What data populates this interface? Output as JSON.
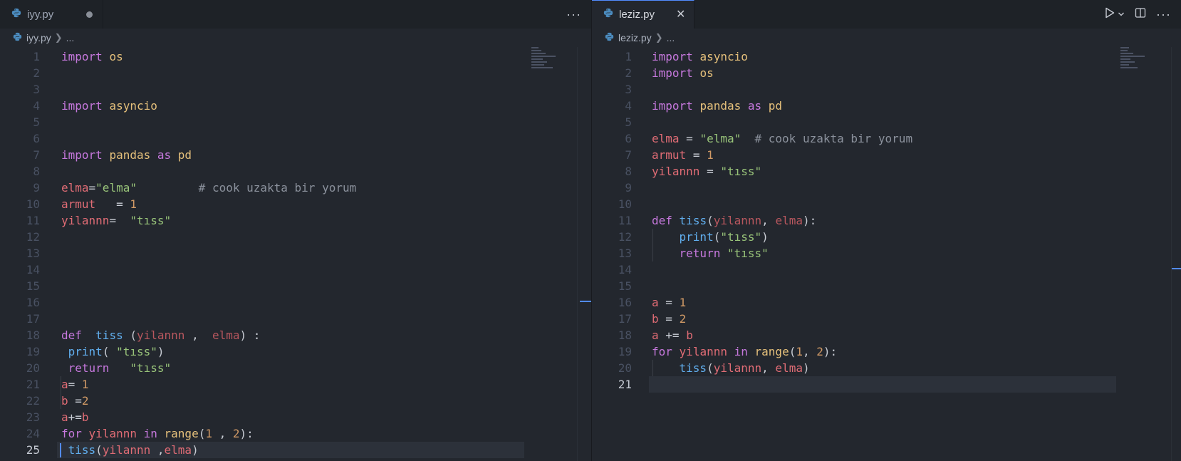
{
  "left": {
    "tab": {
      "label": "iyy.py",
      "modified": true
    },
    "breadcrumb": {
      "file": "iyy.py",
      "rest": "..."
    },
    "more_label": "···",
    "current_line": 25,
    "line_numbers": [
      "1",
      "2",
      "3",
      "4",
      "5",
      "6",
      "7",
      "8",
      "9",
      "10",
      "11",
      "12",
      "13",
      "14",
      "15",
      "16",
      "17",
      "18",
      "19",
      "20",
      "21",
      "22",
      "23",
      "24",
      "25"
    ]
  },
  "right": {
    "tab": {
      "label": "leziz.py",
      "close_label": "✕"
    },
    "breadcrumb": {
      "file": "leziz.py",
      "rest": "..."
    },
    "more_label": "···",
    "current_line": 21,
    "line_numbers": [
      "1",
      "2",
      "3",
      "4",
      "5",
      "6",
      "7",
      "8",
      "9",
      "10",
      "11",
      "12",
      "13",
      "14",
      "15",
      "16",
      "17",
      "18",
      "19",
      "20",
      "21"
    ]
  },
  "colors": {
    "accent": "#528bff",
    "keyword": "#c678dd",
    "module": "#e5c07b",
    "variable": "#e06c75",
    "string": "#98c379",
    "number": "#d19a66",
    "function": "#61afef",
    "comment": "#8b919c"
  },
  "icons": {
    "tab_file": "python-file-icon",
    "run": "run-play-icon",
    "run_menu": "chevron-down-icon",
    "split": "split-editor-icon",
    "more": "more-actions-icon"
  }
}
